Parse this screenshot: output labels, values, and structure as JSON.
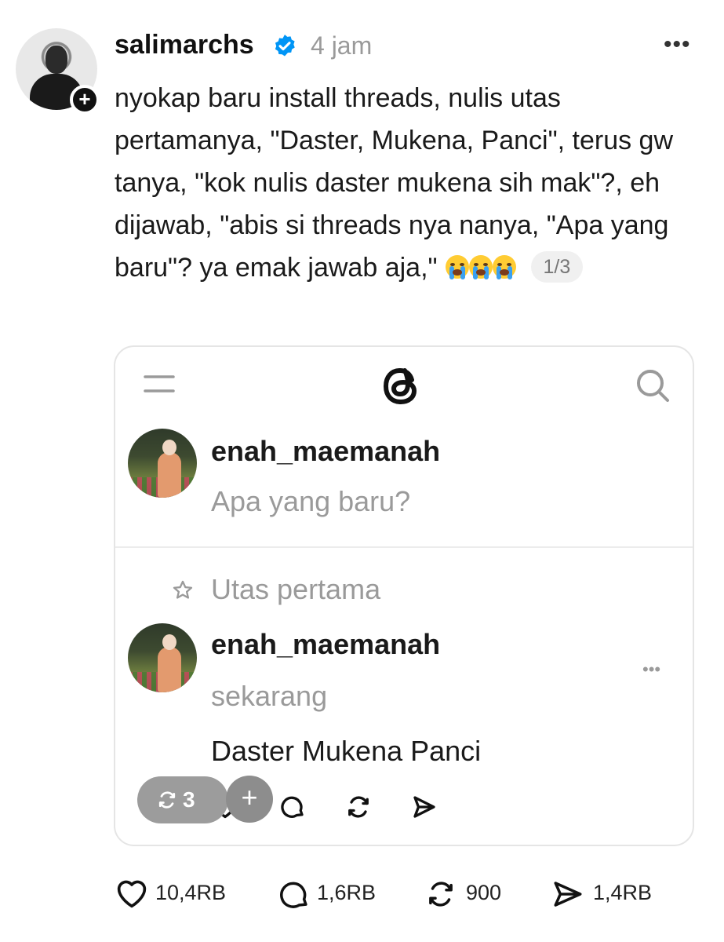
{
  "post": {
    "username": "salimarchs",
    "time": "4 jam",
    "text": "nyokap baru install threads, nulis utas pertamanya, \"Daster, Mukena, Panci\", terus gw tanya, \"kok nulis daster mukena sih mak\"?, eh dijawab, \"abis si threads nya nanya, \"Apa yang baru\"? ya emak jawab aja,\"",
    "emojis": [
      "loudly-crying-face",
      "loudly-crying-face",
      "loudly-crying-face"
    ],
    "page_indicator": "1/3",
    "more_label": "•••",
    "follow_label": "+"
  },
  "embedded": {
    "composer": {
      "username": "enah_maemanah",
      "placeholder": "Apa yang baru?"
    },
    "first_thread": {
      "label": "Utas pertama",
      "username": "enah_maemanah",
      "time": "sekarang",
      "text": "Daster Mukena Panci",
      "more_label": "•••"
    },
    "repost_count": "3",
    "plus_label": "+"
  },
  "stats": {
    "likes": "10,4RB",
    "replies": "1,6RB",
    "reposts": "900",
    "shares": "1,4RB"
  },
  "colors": {
    "text": "#111111",
    "muted": "#9a9a9a",
    "verified": "#0095f6",
    "card_border": "#e5e5e5"
  }
}
